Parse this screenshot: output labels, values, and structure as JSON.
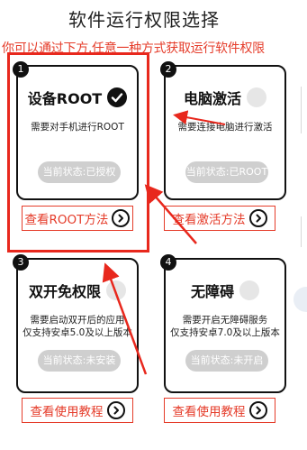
{
  "title": "软件运行权限选择",
  "subtitle": "你可以通过下方,任意一种方式获取运行软件权限",
  "colors": {
    "accent": "#e53c2a",
    "pill": "#cfcfcf",
    "card_border": "#111111"
  },
  "cards": [
    {
      "num": "1",
      "title": "设备ROOT",
      "desc": "需要对手机进行ROOT",
      "status": "当前状态:已授权",
      "authorized": true,
      "link": "查看ROOT方法"
    },
    {
      "num": "2",
      "title": "电脑激活",
      "desc": "需要连接电脑进行激活",
      "status": "当前状态:已ROOT",
      "authorized": false,
      "link": "查看激活方法"
    },
    {
      "num": "3",
      "title": "双开免权限",
      "desc": "需要启动双开后的应用\n仅支持安卓5.0及以上版本",
      "status": "当前状态:未安装",
      "authorized": false,
      "link": "查看使用教程"
    },
    {
      "num": "4",
      "title": "无障碍",
      "desc": "需要开启无障碍服务\n仅支持安卓7.0及以上版本",
      "status": "当前状态:未开启",
      "authorized": false,
      "link": "查看使用教程"
    }
  ]
}
